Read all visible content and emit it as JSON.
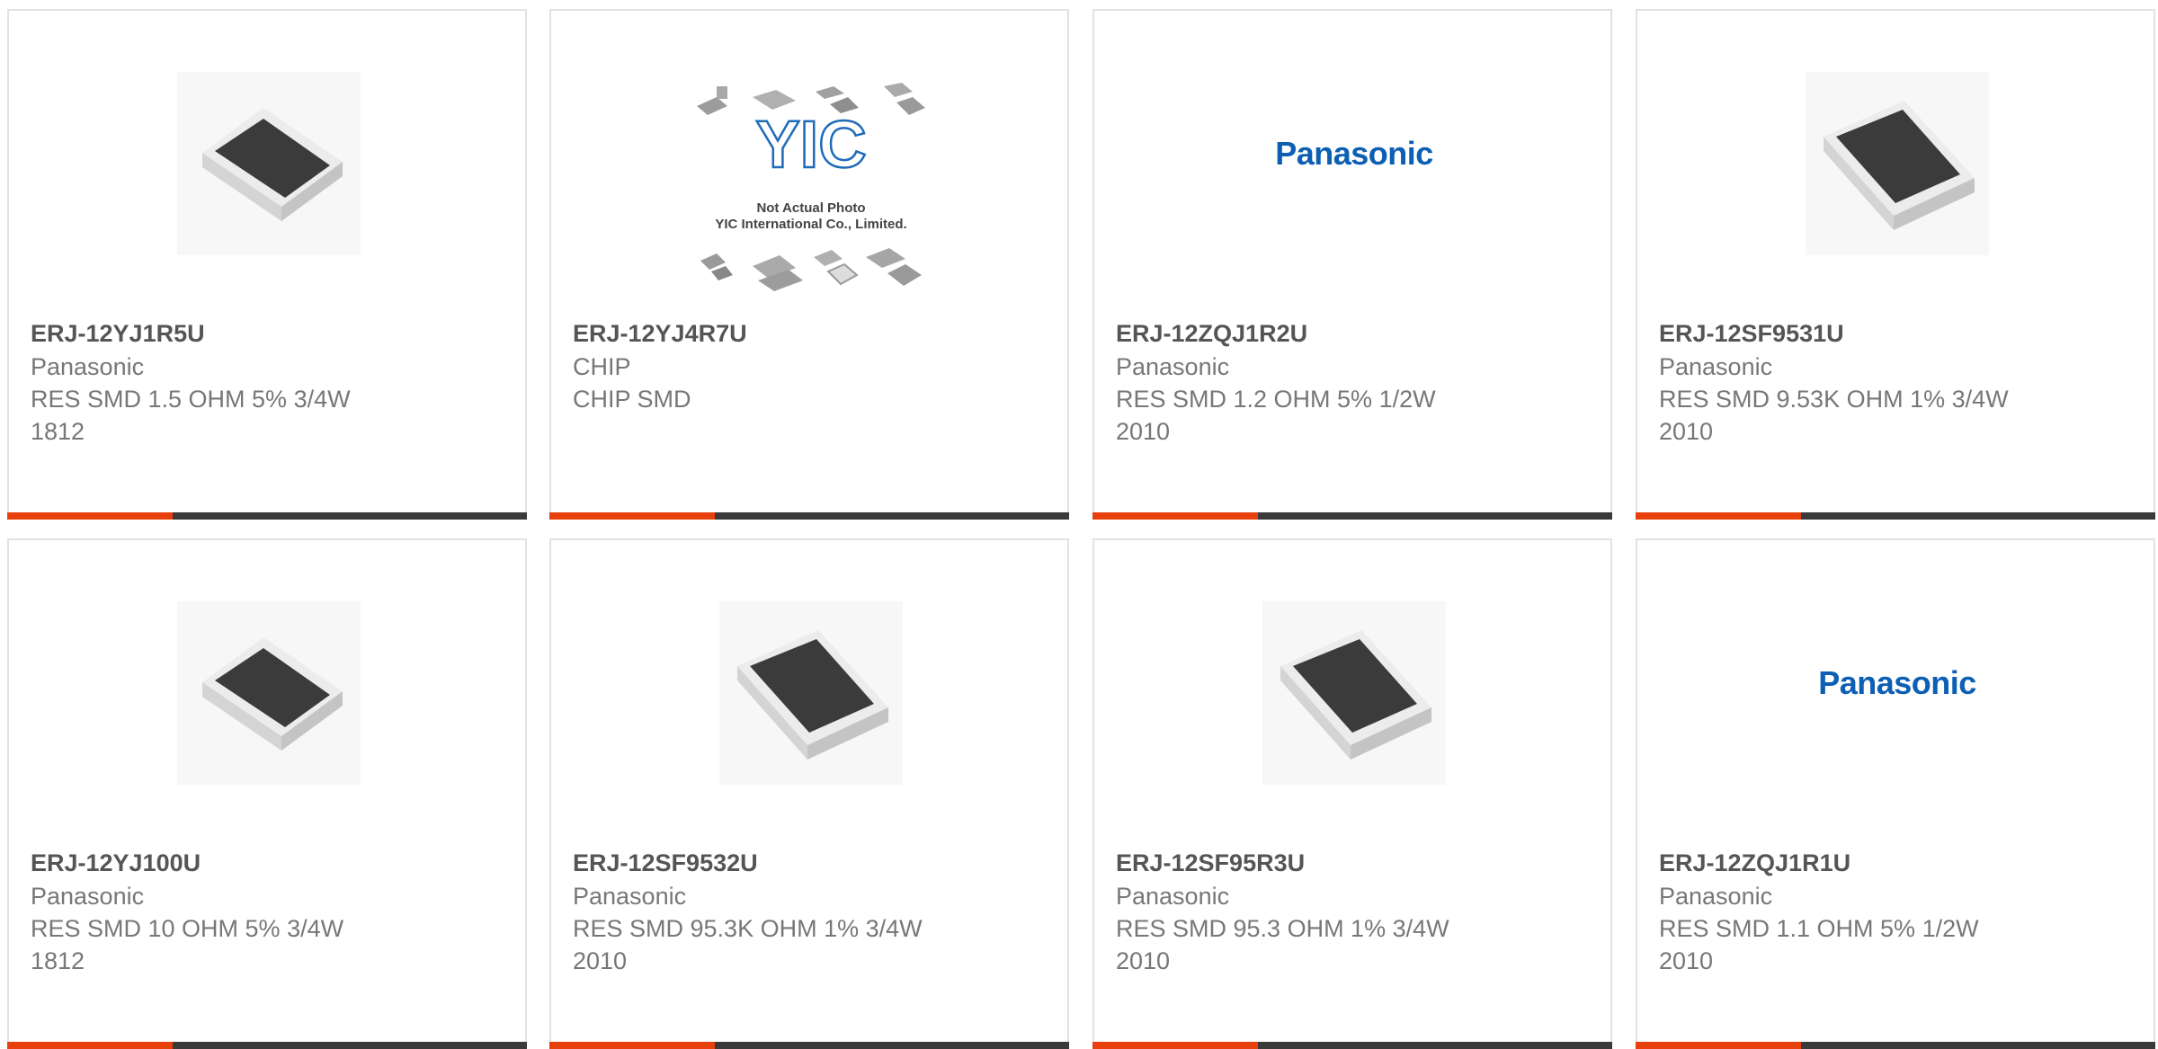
{
  "colors": {
    "accent": "#e8400c",
    "bar": "#3a3a3a",
    "brand_blue": "#0d5fb3",
    "card_border": "#e2e2e2"
  },
  "products": [
    {
      "part_number": "ERJ-12YJ1R5U",
      "manufacturer": "Panasonic",
      "description": "RES SMD 1.5 OHM 5% 3/4W",
      "package": "1812",
      "image": "resistor-chip-photo"
    },
    {
      "part_number": "ERJ-12YJ4R7U",
      "manufacturer": "CHIP",
      "description": "CHIP SMD",
      "package": "",
      "image": "yic-placeholder-photo",
      "image_caption_1": "Not Actual Photo",
      "image_caption_2": "YIC International Co., Limited.",
      "image_logo": "YIC"
    },
    {
      "part_number": "ERJ-12ZQJ1R2U",
      "manufacturer": "Panasonic",
      "description": "RES SMD 1.2 OHM 5% 1/2W",
      "package": "2010",
      "image": "panasonic-logo",
      "image_logo": "Panasonic"
    },
    {
      "part_number": "ERJ-12SF9531U",
      "manufacturer": "Panasonic",
      "description": "RES SMD 9.53K OHM 1% 3/4W",
      "package": "2010",
      "image": "resistor-chip-photo"
    },
    {
      "part_number": "ERJ-12YJ100U",
      "manufacturer": "Panasonic",
      "description": "RES SMD 10 OHM 5% 3/4W",
      "package": "1812",
      "image": "resistor-chip-photo"
    },
    {
      "part_number": "ERJ-12SF9532U",
      "manufacturer": "Panasonic",
      "description": "RES SMD 95.3K OHM 1% 3/4W",
      "package": "2010",
      "image": "resistor-chip-photo"
    },
    {
      "part_number": "ERJ-12SF95R3U",
      "manufacturer": "Panasonic",
      "description": "RES SMD 95.3 OHM 1% 3/4W",
      "package": "2010",
      "image": "resistor-chip-photo"
    },
    {
      "part_number": "ERJ-12ZQJ1R1U",
      "manufacturer": "Panasonic",
      "description": "RES SMD 1.1 OHM 5% 1/2W",
      "package": "2010",
      "image": "panasonic-logo",
      "image_logo": "Panasonic"
    }
  ]
}
